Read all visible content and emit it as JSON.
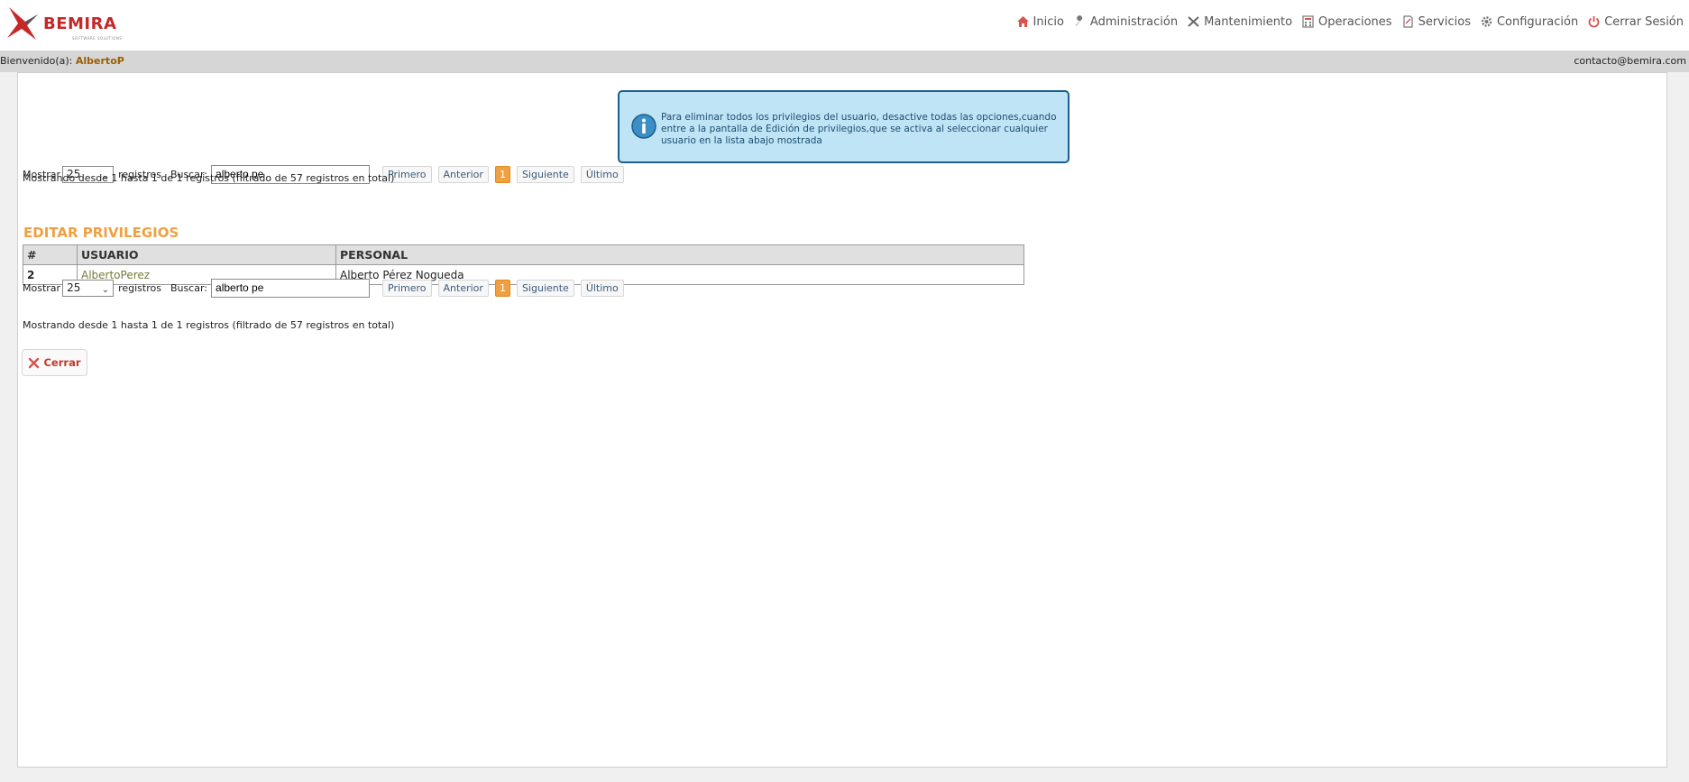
{
  "header": {
    "logo_text": "BEMIRA",
    "logo_subtext": "SOFTWARE SOLUTIONS",
    "nav": [
      {
        "label": "Inicio",
        "icon": "home-icon"
      },
      {
        "label": "Administración",
        "icon": "wrench-icon"
      },
      {
        "label": "Mantenimiento",
        "icon": "tools-icon"
      },
      {
        "label": "Operaciones",
        "icon": "calculator-icon"
      },
      {
        "label": "Servicios",
        "icon": "document-icon"
      },
      {
        "label": "Configuración",
        "icon": "gear-icon"
      },
      {
        "label": "Cerrar Sesión",
        "icon": "power-icon"
      }
    ]
  },
  "welcome": {
    "prefix": "Bienvenido(a):",
    "user": "AlbertoP",
    "email": "contacto@bemira.com"
  },
  "info": {
    "text": "Para eliminar todos los privilegios del usuario, desactive todas las opciones,cuando entre a la pantalla de Edición de privilegios,que se activa al seleccionar cualquier usuario en la lista abajo mostrada"
  },
  "controls": {
    "show_label": "Mostrar",
    "page_size": "25",
    "records_label": "registros",
    "search_label": "Buscar:",
    "search_value": "alberto pe",
    "first": "Primero",
    "previous": "Anterior",
    "current_page": "1",
    "next": "Siguiente",
    "last": "Último",
    "showing_text": "Mostrando desde 1 hasta 1 de 1 registros (filtrado de 57 registros en total)"
  },
  "title": "EDITAR PRIVILEGIOS",
  "table": {
    "headers": [
      "#",
      "USUARIO",
      "PERSONAL"
    ],
    "rows": [
      {
        "num": "2",
        "usuario": "AlbertoPerez",
        "personal": "Alberto Pérez Nogueda"
      }
    ]
  },
  "close_label": "Cerrar",
  "colors": {
    "accent": "#f0a040",
    "info_bg": "#bfe4f5",
    "info_border": "#1d5f8a",
    "close_red": "#c0392b"
  }
}
